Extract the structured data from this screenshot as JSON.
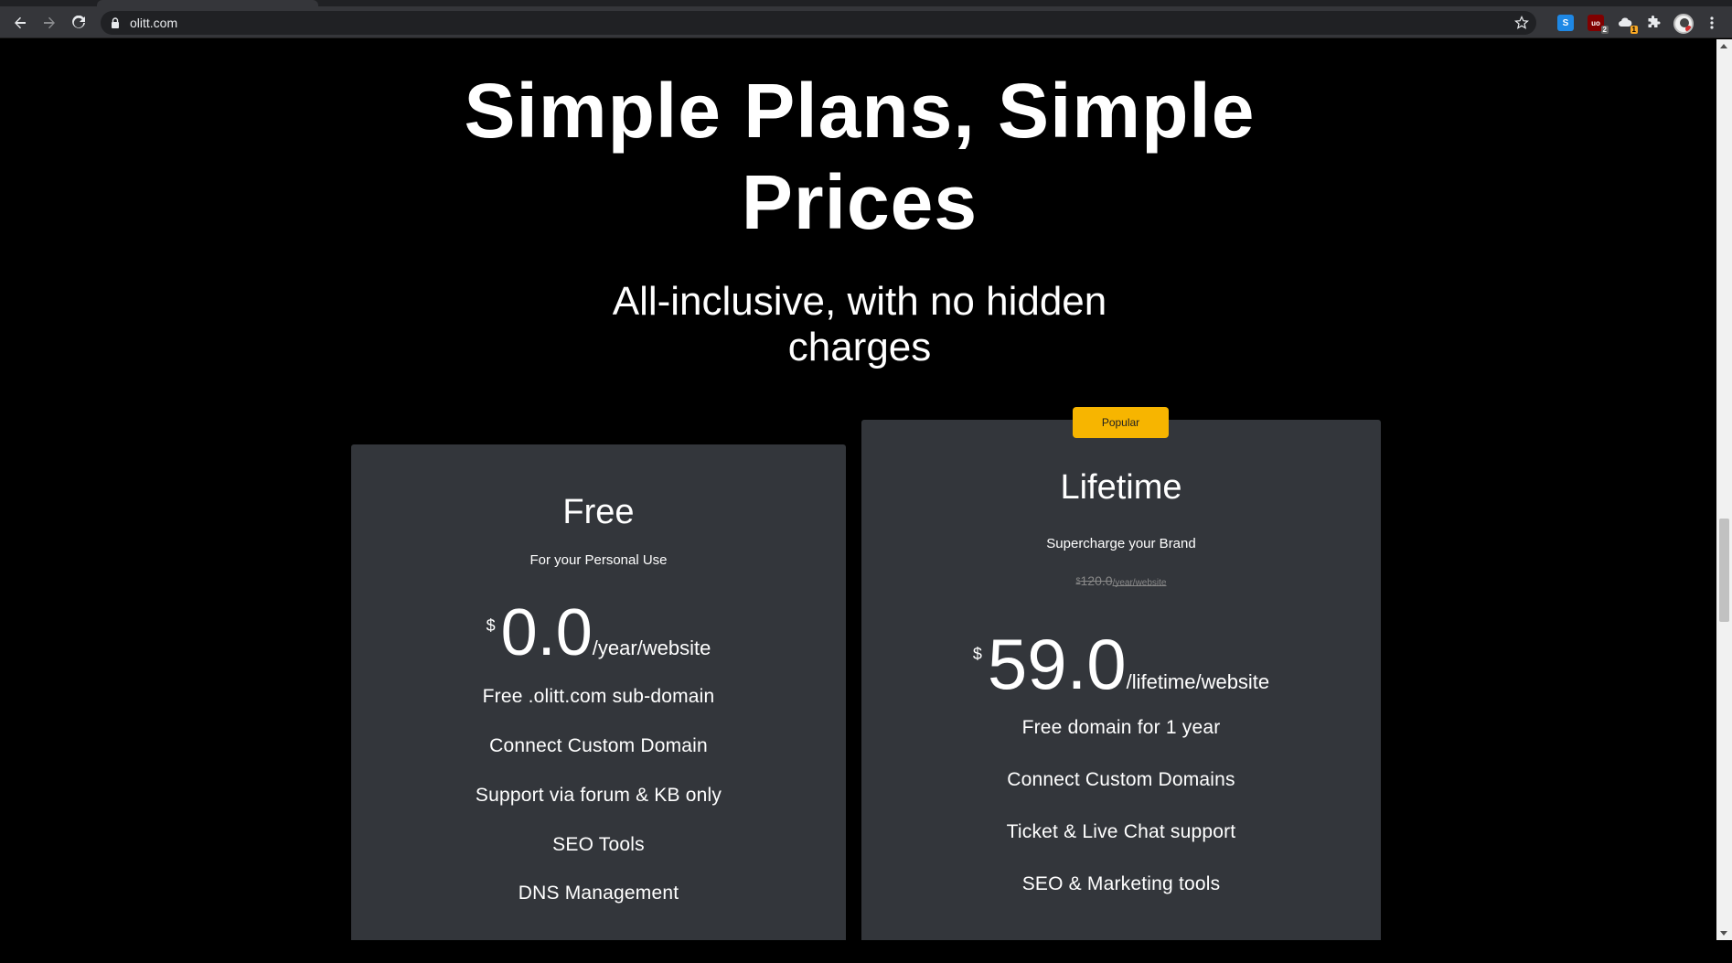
{
  "browser": {
    "url": "olitt.com"
  },
  "hero": {
    "title_line1": "Simple Plans, Simple",
    "title_line2": "Prices",
    "subtitle_line1": "All-inclusive, with no hidden",
    "subtitle_line2": "charges"
  },
  "plans": [
    {
      "name": "Free",
      "tagline": "For your Personal Use",
      "currency": "$",
      "amount": "0.0",
      "period": "/year/website",
      "features": [
        "Free .olitt.com sub-domain",
        "Connect Custom Domain",
        "Support via forum & KB only",
        "SEO Tools",
        "DNS Management"
      ]
    },
    {
      "badge": "Popular",
      "name": "Lifetime",
      "tagline": "Supercharge your Brand",
      "old_currency": "$",
      "old_amount": "120.0",
      "old_period": "/year/website",
      "currency": "$",
      "amount": "59.0",
      "period": "/lifetime/website",
      "features": [
        "Free domain for 1 year",
        "Connect Custom Domains",
        "Ticket & Live Chat support",
        "SEO & Marketing tools"
      ]
    }
  ],
  "colors": {
    "page_background": "#000000",
    "card_background": "#33363b",
    "badge_background": "#f7b500"
  }
}
